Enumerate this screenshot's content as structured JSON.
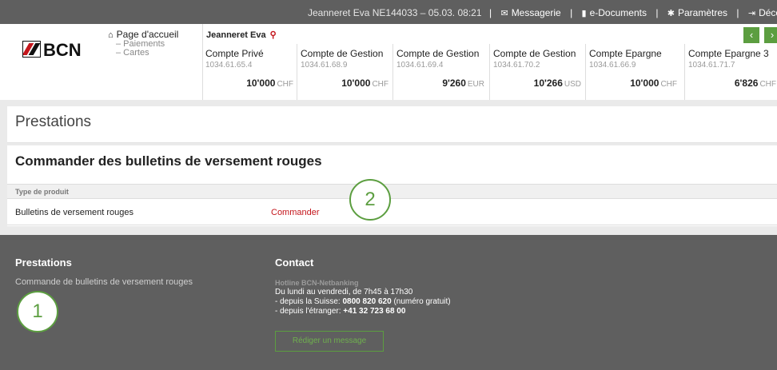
{
  "topbar": {
    "user_info": "Jeanneret Eva   NE144033 – 05.03. 08:21",
    "items": [
      {
        "icon": "envelope-icon",
        "label": "Messagerie"
      },
      {
        "icon": "document-icon",
        "label": "e-Documents"
      },
      {
        "icon": "gear-icon",
        "label": "Paramètres"
      },
      {
        "icon": "logout-icon",
        "label": "Déconnexion"
      }
    ]
  },
  "header": {
    "logo": "BCN",
    "nav": {
      "home": "Page d'accueil",
      "sub": [
        "– Paiements",
        "– Cartes"
      ]
    },
    "owner": "Jeanneret Eva",
    "accounts": [
      {
        "name": "Compte Privé",
        "number": "1034.61.65.4",
        "balance": "10'000",
        "currency": "CHF"
      },
      {
        "name": "Compte de Gestion",
        "number": "1034.61.68.9",
        "balance": "10'000",
        "currency": "CHF"
      },
      {
        "name": "Compte de Gestion",
        "number": "1034.61.69.4",
        "balance": "9'260",
        "currency": "EUR"
      },
      {
        "name": "Compte de Gestion",
        "number": "1034.61.70.2",
        "balance": "10'266",
        "currency": "USD"
      },
      {
        "name": "Compte Epargne",
        "number": "1034.61.66.9",
        "balance": "10'000",
        "currency": "CHF"
      },
      {
        "name": "Compte Epargne 3",
        "number": "1034.61.71.7",
        "balance": "6'826",
        "currency": "CHF"
      }
    ]
  },
  "main": {
    "page_title": "Prestations",
    "section_title": "Commander des bulletins de versement rouges",
    "table_header": "Type de produit",
    "row": {
      "product": "Bulletins de versement rouges",
      "action": "Commander"
    }
  },
  "steps": [
    "1",
    "2"
  ],
  "footer": {
    "prestations_title": "Prestations",
    "prestations_text": "Commande de bulletins de versement rouges",
    "contact_title": "Contact",
    "hotline": "Hotline BCN-Netbanking",
    "hours": "Du lundi au vendredi, de 7h45 à 17h30",
    "swiss_prefix": "- depuis la Suisse: ",
    "swiss_number": "0800 820 620",
    "swiss_suffix": " (numéro gratuit)",
    "abroad_prefix": "- depuis l'étranger: ",
    "abroad_number": "+41 32 723 68 00",
    "message_button": "Rédiger un message"
  },
  "colors": {
    "accent_green": "#5c9e40",
    "brand_red": "#c4161c",
    "bar_grey": "#5f5f5f"
  }
}
